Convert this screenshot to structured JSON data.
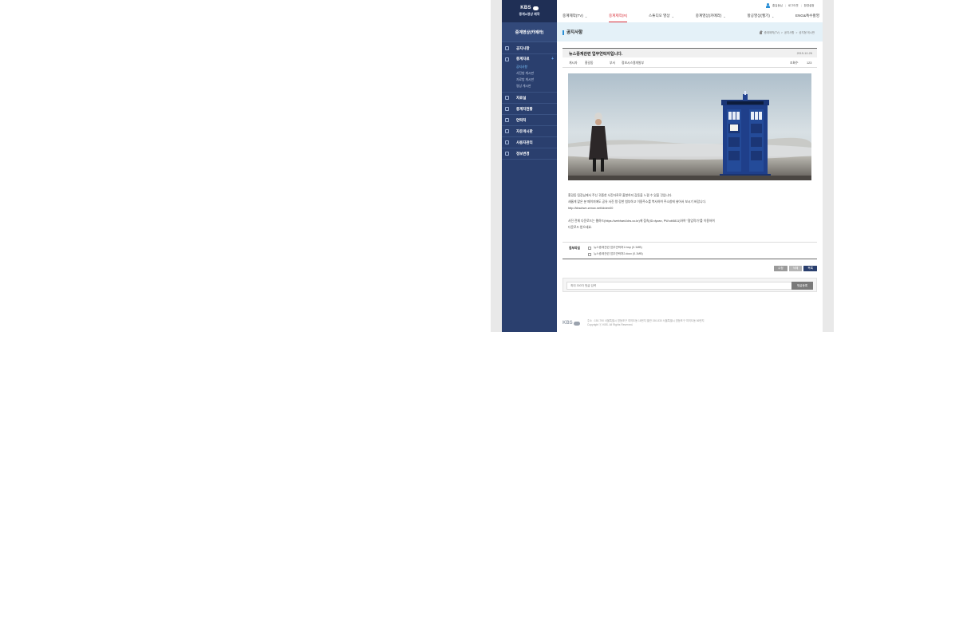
{
  "sidebar": {
    "brand": "KBS",
    "system_name": "중계&영상 제작",
    "heading": "중계영상(카메라)",
    "items": [
      {
        "label": "공지사항"
      },
      {
        "label": "중계자료"
      },
      {
        "label": "자료실"
      },
      {
        "label": "중계차현황"
      },
      {
        "label": "연락처"
      },
      {
        "label": "자유게시판"
      },
      {
        "label": "사용자관리"
      },
      {
        "label": "정보변경"
      }
    ],
    "open_item_plus": "+",
    "submenu": [
      {
        "label": "공지사항"
      },
      {
        "label": "사진방 게시판"
      },
      {
        "label": "자료방 게시판"
      },
      {
        "label": "영상 게시판"
      }
    ]
  },
  "util_links": [
    "홍길동님",
    "로그아웃",
    "환경설정"
  ],
  "gnb": [
    {
      "label": "중계제작(TV)"
    },
    {
      "label": "중계제작(R)"
    },
    {
      "label": "스튜디오 영상"
    },
    {
      "label": "중계영상(카메라)"
    },
    {
      "label": "항공영상(헬기)"
    },
    {
      "label": "ENG&특수촬영"
    }
  ],
  "title_bar": {
    "title": "공지사항",
    "breadcrumb": [
      "중계제작(TV)",
      "공지사항",
      "공지형 게시판"
    ]
  },
  "post": {
    "title": "뉴스중계관련 업무연락자입니다.",
    "date": "2015-10-26",
    "author_label": "게시자",
    "author": "홍길동",
    "dept_label": "부서",
    "dept": "정보시스템개발부",
    "views_label": "조회수",
    "views": "123",
    "body": [
      "홍길동 팀장님께서 주신 귀중한 사진자료로 출항하지 감동을 느낄 수 있을 것입니다.",
      "새롭게 맡은 분 페이지에도 공유 사진 왕 강한 첨부하고 이용주소를 복사하여 주소창에 넣어서 보시기 바랍니다.",
      "http://kbsdrwn.zenox.net/idvien00",
      "",
      "사진 전체 다운로드는 웹하드(https://webhard.kbs.co.kr)에 접속(ID:dyvan, PW:ob5811)하여 \"협업작가\"를 이용하여",
      "다운로드 받으세요."
    ],
    "attachments_label": "첨부파일",
    "attachments": [
      "뉴스중계관련 업무연락처1.hwp (0.1MB)",
      "뉴스중계관련 업무연락처2.docx (0.1MB)"
    ]
  },
  "buttons": {
    "edit": "수정",
    "delete": "삭제",
    "list": "목록"
  },
  "comment": {
    "placeholder": "최대 300자 댓글 입력",
    "submit": "댓글등록"
  },
  "footer": {
    "logo": "KBS",
    "address": "주소 : 150-790 서울특별시 영등포구 여의도동 18번지 별관 150-830 서울특별시 영등포구 여의도동 56번지",
    "copyright": "Copyright ⓒ KBS. All Rights Reserved."
  },
  "colors": {
    "sidebar": "#2a3f6e",
    "active_nav": "#d8303a",
    "accent": "#2a8fd6",
    "title_bar_bg": "#e4f1f8"
  }
}
